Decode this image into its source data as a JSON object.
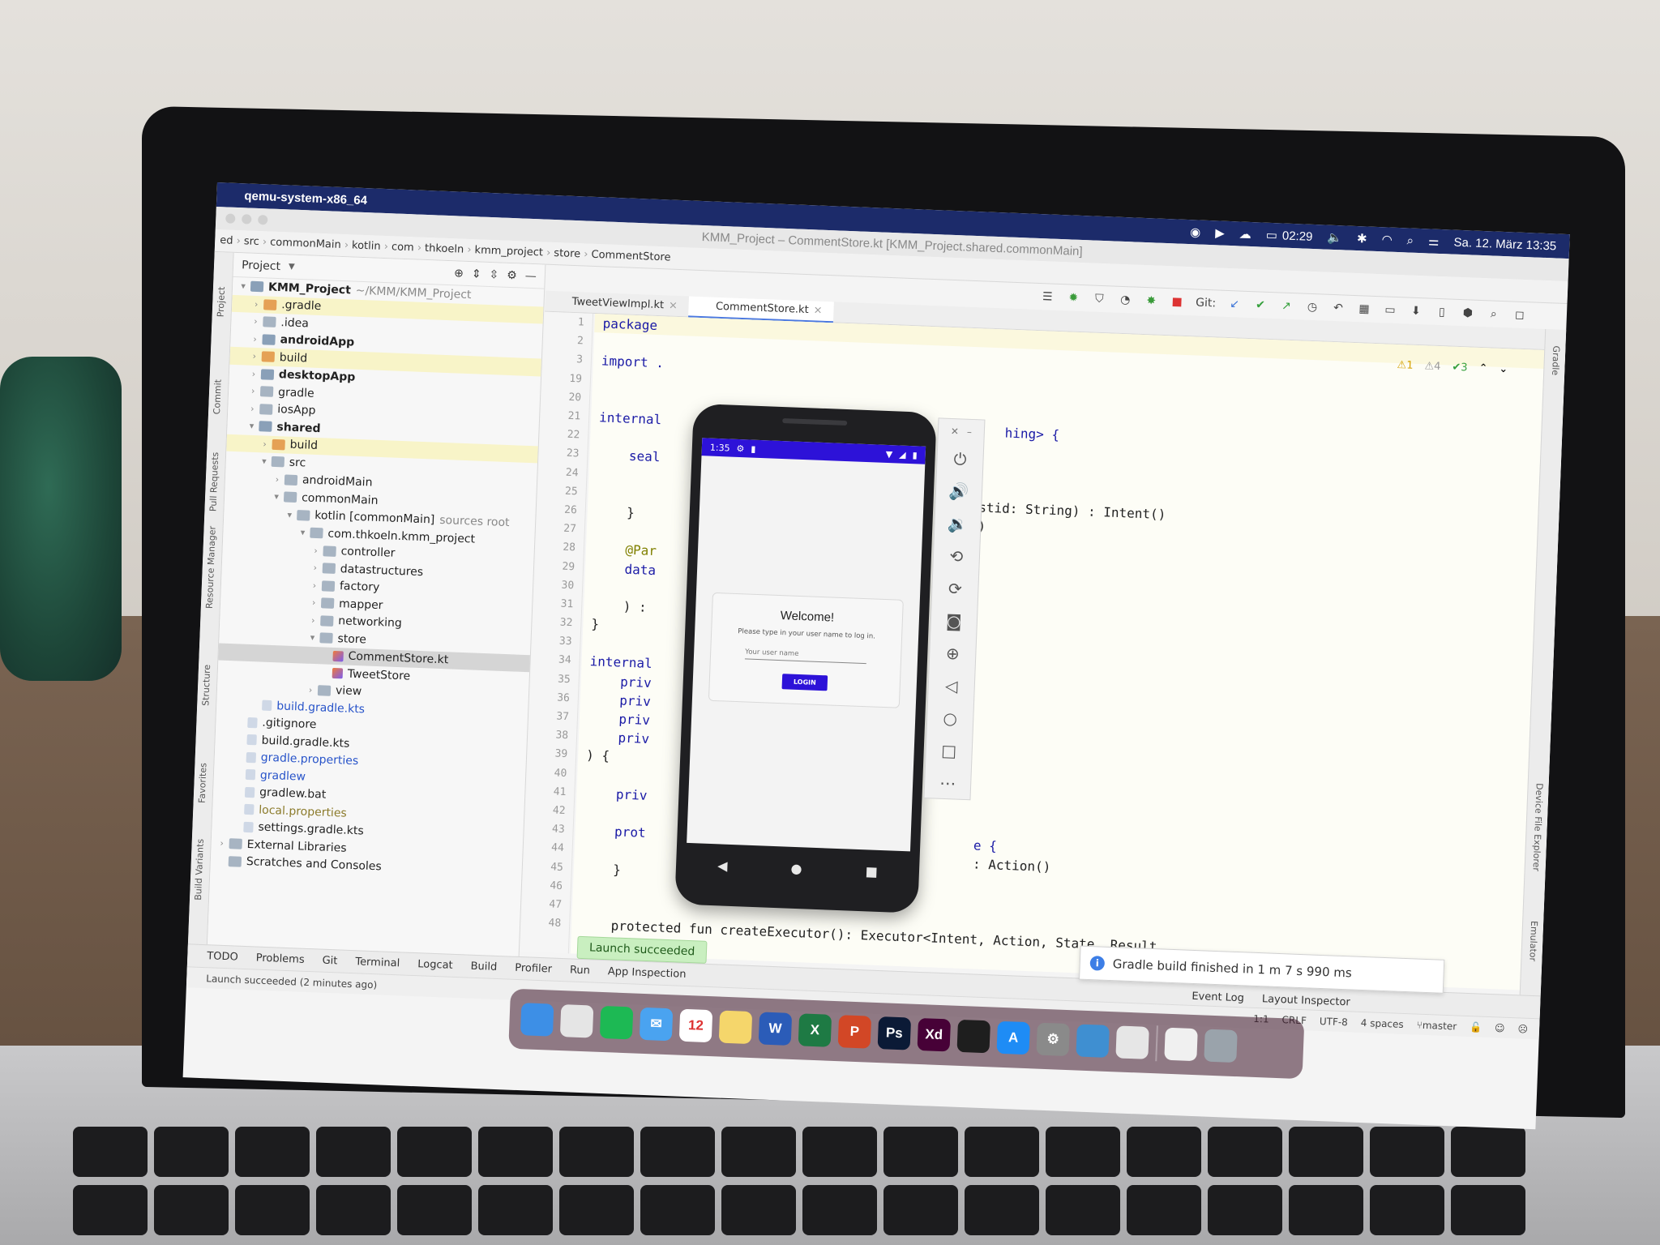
{
  "menubar": {
    "app_name": "qemu-system-x86_64",
    "time": "02:29",
    "date_time": "Sa. 12. März  13:35"
  },
  "window": {
    "title": "KMM_Project – CommentStore.kt [KMM_Project.shared.commonMain]"
  },
  "breadcrumb": [
    "ed",
    "src",
    "commonMain",
    "kotlin",
    "com",
    "thkoeln",
    "kmm_project",
    "store",
    "CommentStore"
  ],
  "toolbar": {
    "git_label": "Git:"
  },
  "left_strip": [
    "Project",
    "Commit",
    "Pull Requests",
    "Resource Manager",
    "Structure",
    "Favorites",
    "Build Variants"
  ],
  "right_strip": [
    "Gradle",
    "Device File Explorer",
    "Emulator"
  ],
  "project_panel": {
    "header": "Project",
    "tree": [
      {
        "label": "KMM_Project",
        "note": "~/KMM/KMM_Project",
        "indent": 0,
        "icon": "module",
        "chev": "▾",
        "bold": true
      },
      {
        "label": ".gradle",
        "indent": 1,
        "icon": "folder-o",
        "chev": "›",
        "hl": true
      },
      {
        "label": ".idea",
        "indent": 1,
        "icon": "folder",
        "chev": "›"
      },
      {
        "label": "androidApp",
        "indent": 1,
        "icon": "module",
        "chev": "›",
        "bold": true
      },
      {
        "label": "build",
        "indent": 1,
        "icon": "folder-o",
        "chev": "›",
        "hl": true
      },
      {
        "label": "desktopApp",
        "indent": 1,
        "icon": "module",
        "chev": "›",
        "bold": true
      },
      {
        "label": "gradle",
        "indent": 1,
        "icon": "folder",
        "chev": "›"
      },
      {
        "label": "iosApp",
        "indent": 1,
        "icon": "folder",
        "chev": "›"
      },
      {
        "label": "shared",
        "indent": 1,
        "icon": "module",
        "chev": "▾",
        "bold": true
      },
      {
        "label": "build",
        "indent": 2,
        "icon": "folder-o",
        "chev": "›",
        "hl": true
      },
      {
        "label": "src",
        "indent": 2,
        "icon": "folder",
        "chev": "▾"
      },
      {
        "label": "androidMain",
        "indent": 3,
        "icon": "folder",
        "chev": "›"
      },
      {
        "label": "commonMain",
        "indent": 3,
        "icon": "folder",
        "chev": "▾"
      },
      {
        "label": "kotlin [commonMain]",
        "note": "sources root",
        "indent": 4,
        "icon": "folder",
        "chev": "▾"
      },
      {
        "label": "com.thkoeln.kmm_project",
        "indent": 5,
        "icon": "folder",
        "chev": "▾"
      },
      {
        "label": "controller",
        "indent": 6,
        "icon": "folder",
        "chev": "›"
      },
      {
        "label": "datastructures",
        "indent": 6,
        "icon": "folder",
        "chev": "›"
      },
      {
        "label": "factory",
        "indent": 6,
        "icon": "folder",
        "chev": "›"
      },
      {
        "label": "mapper",
        "indent": 6,
        "icon": "folder",
        "chev": "›"
      },
      {
        "label": "networking",
        "indent": 6,
        "icon": "folder",
        "chev": "›"
      },
      {
        "label": "store",
        "indent": 6,
        "icon": "folder",
        "chev": "▾"
      },
      {
        "label": "CommentStore.kt",
        "indent": 7,
        "icon": "kt",
        "chev": "",
        "sel": true
      },
      {
        "label": "TweetStore",
        "indent": 7,
        "icon": "kt",
        "chev": ""
      },
      {
        "label": "view",
        "indent": 6,
        "icon": "folder",
        "chev": "›"
      },
      {
        "label": "build.gradle.kts",
        "indent": 2,
        "icon": "file",
        "chev": "",
        "color": "blue"
      },
      {
        "label": ".gitignore",
        "indent": 1,
        "icon": "file",
        "chev": ""
      },
      {
        "label": "build.gradle.kts",
        "indent": 1,
        "icon": "file",
        "chev": ""
      },
      {
        "label": "gradle.properties",
        "indent": 1,
        "icon": "file",
        "chev": "",
        "color": "blue"
      },
      {
        "label": "gradlew",
        "indent": 1,
        "icon": "file",
        "chev": "",
        "color": "blue"
      },
      {
        "label": "gradlew.bat",
        "indent": 1,
        "icon": "file",
        "chev": ""
      },
      {
        "label": "local.properties",
        "indent": 1,
        "icon": "file",
        "chev": "",
        "color": "olive"
      },
      {
        "label": "settings.gradle.kts",
        "indent": 1,
        "icon": "file",
        "chev": ""
      },
      {
        "label": "External Libraries",
        "indent": 0,
        "icon": "folder",
        "chev": "›"
      },
      {
        "label": "Scratches and Consoles",
        "indent": 0,
        "icon": "folder",
        "chev": ""
      }
    ]
  },
  "editor": {
    "tabs": [
      "TweetViewImpl.kt",
      "CommentStore.kt"
    ],
    "active_tab": 1,
    "line_numbers": [
      "1",
      "2",
      "3",
      "19",
      "20",
      "21",
      "22",
      "23",
      "24",
      "25",
      "26",
      "27",
      "28",
      "29",
      "30",
      "31",
      "32",
      "33",
      "34",
      "35",
      "36",
      "37",
      "38",
      "39",
      "40",
      "41",
      "42",
      "43",
      "44",
      "45",
      "46",
      "47",
      "48"
    ],
    "inspections": {
      "warnings": "⚠1",
      "weak": "⚠4",
      "ok": "✔3"
    },
    "lines": [
      {
        "t": "package",
        "cls": "kw"
      },
      {
        "t": "",
        "cls": ""
      },
      {
        "t": "import .",
        "cls": "kw"
      },
      {
        "t": "",
        "cls": ""
      },
      {
        "t": "",
        "cls": ""
      },
      {
        "t": "internal                                            hing> {",
        "cls": "kw"
      },
      {
        "t": "",
        "cls": ""
      },
      {
        "t": "    seal",
        "cls": "kw"
      },
      {
        "t": "",
        "cls": ""
      },
      {
        "t": "                                                 stid: String) : Intent()",
        "cls": ""
      },
      {
        "t": "    }                                            )",
        "cls": ""
      },
      {
        "t": "",
        "cls": ""
      },
      {
        "t": "    @Par",
        "cls": "ann"
      },
      {
        "t": "    data",
        "cls": "kw"
      },
      {
        "t": "",
        "cls": ""
      },
      {
        "t": "    ) :",
        "cls": ""
      },
      {
        "t": "}",
        "cls": ""
      },
      {
        "t": "",
        "cls": ""
      },
      {
        "t": "internal",
        "cls": "kw"
      },
      {
        "t": "    priv",
        "cls": "kw"
      },
      {
        "t": "    priv",
        "cls": "kw"
      },
      {
        "t": "    priv",
        "cls": "kw"
      },
      {
        "t": "    priv",
        "cls": "kw"
      },
      {
        "t": ") {",
        "cls": ""
      },
      {
        "t": "",
        "cls": ""
      },
      {
        "t": "    priv",
        "cls": "kw"
      },
      {
        "t": "",
        "cls": ""
      },
      {
        "t": "    prot                                          e {",
        "cls": "kw"
      },
      {
        "t": "                                                  : Action()",
        "cls": ""
      },
      {
        "t": "    }",
        "cls": ""
      },
      {
        "t": "",
        "cls": ""
      },
      {
        "t": "",
        "cls": ""
      },
      {
        "t": "    protected fun createExecutor(): Executor<Intent, Action, State, Result",
        "cls": ""
      }
    ]
  },
  "bottom_tools": [
    "TODO",
    "Problems",
    "Git",
    "Terminal",
    "Logcat",
    "Build",
    "Profiler",
    "Run",
    "App Inspection"
  ],
  "status": {
    "message": "Launch succeeded (2 minutes ago)",
    "position": "1:1",
    "line_sep": "CRLF",
    "encoding": "UTF-8",
    "indent": "4 spaces",
    "branch": "master",
    "event_log": "Event Log",
    "layout_inspector": "Layout Inspector"
  },
  "popups": {
    "launch": "Launch succeeded",
    "gradle": "Gradle build finished in 1 m 7 s 990 ms"
  },
  "phone": {
    "time": "1:35",
    "welcome": "Welcome!",
    "instruction": "Please type in your user name to log in.",
    "placeholder": "Your user name",
    "login_label": "LOGIN"
  },
  "dock": [
    {
      "name": "finder",
      "bg": "#3d8fe6",
      "glyph": ""
    },
    {
      "name": "chrome",
      "bg": "#e5e5e5",
      "glyph": ""
    },
    {
      "name": "spotify",
      "bg": "#1db954",
      "glyph": ""
    },
    {
      "name": "mail",
      "bg": "#4aa3f0",
      "glyph": "✉"
    },
    {
      "name": "calendar",
      "bg": "#ffffff",
      "glyph": "12"
    },
    {
      "name": "notes",
      "bg": "#f5d66b",
      "glyph": ""
    },
    {
      "name": "word",
      "bg": "#2b5cb8",
      "glyph": "W"
    },
    {
      "name": "excel",
      "bg": "#1e7a44",
      "glyph": "X"
    },
    {
      "name": "powerpoint",
      "bg": "#d24726",
      "glyph": "P"
    },
    {
      "name": "photoshop",
      "bg": "#0b1a36",
      "glyph": "Ps"
    },
    {
      "name": "xd",
      "bg": "#470137",
      "glyph": "Xd"
    },
    {
      "name": "figma",
      "bg": "#1e1e1e",
      "glyph": ""
    },
    {
      "name": "app-store",
      "bg": "#1e8cf5",
      "glyph": "A"
    },
    {
      "name": "system-preferences",
      "bg": "#8a8a8a",
      "glyph": "⚙"
    },
    {
      "name": "android-studio",
      "bg": "#3f8fd1",
      "glyph": ""
    },
    {
      "name": "other-app",
      "bg": "#e6e6e6",
      "glyph": ""
    },
    {
      "name": "document",
      "bg": "#f0f0f0",
      "glyph": ""
    },
    {
      "name": "trash",
      "bg": "#9aa3ab",
      "glyph": ""
    }
  ]
}
